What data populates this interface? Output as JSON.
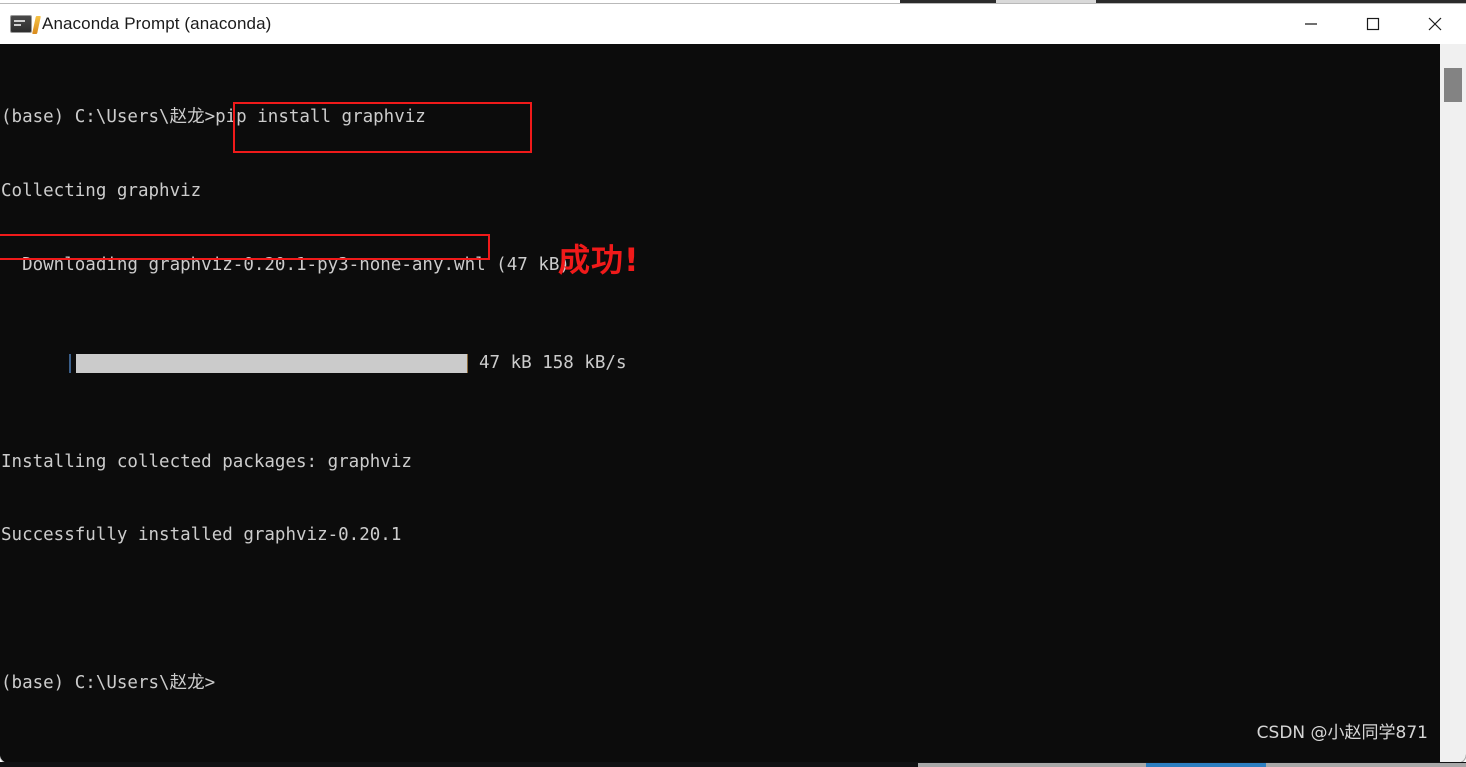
{
  "window": {
    "title": "Anaconda Prompt (anaconda)",
    "icon": "console-icon",
    "controls": {
      "minimize_label": "Minimize",
      "maximize_label": "Maximize",
      "close_label": "Close"
    }
  },
  "terminal": {
    "background_color": "#0c0c0c",
    "text_color": "#cccccc",
    "lines": [
      "(base) C:\\Users\\赵龙>pip install graphviz",
      "Collecting graphviz",
      "  Downloading graphviz-0.20.1-py3-none-any.whl (47 kB)"
    ],
    "progress": {
      "bar_glyph": "|",
      "stats": "47 kB 158 kB/s",
      "fill_percent": 100
    },
    "lines_after": [
      "Installing collected packages: graphviz",
      "Successfully installed graphviz-0.20.1",
      "",
      "(base) C:\\Users\\赵龙>"
    ]
  },
  "annotations": {
    "color": "#f01a1a",
    "command_box_target": "pip install graphviz",
    "success_box_target": "Successfully installed graphviz-0.20.1",
    "success_note": "成功!"
  },
  "watermark": {
    "text": "CSDN @小赵同学871"
  },
  "scrollbar": {
    "track_color": "#f0f0f0",
    "thumb_color": "#838383"
  }
}
